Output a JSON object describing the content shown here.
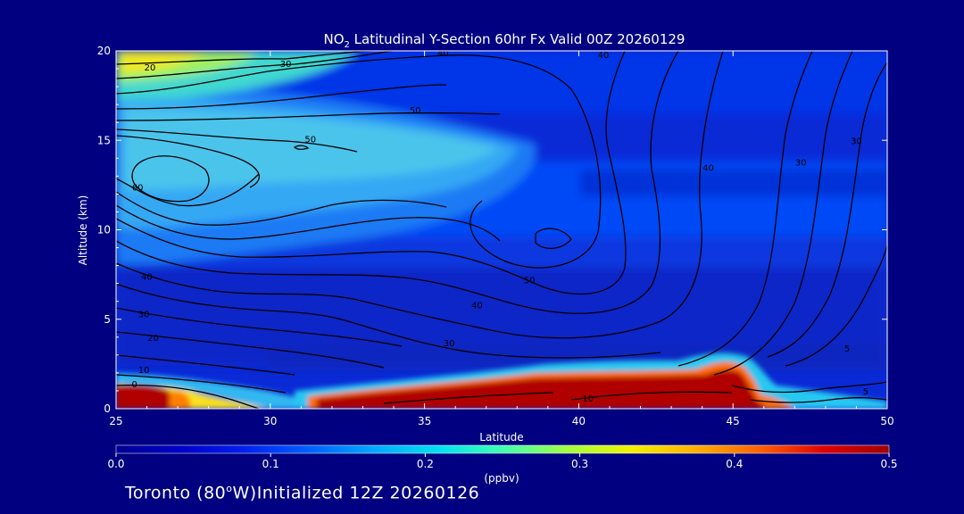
{
  "chart_data": {
    "type": "heatmap",
    "title_prefix": "NO",
    "title_sub": "2",
    "title_suffix": " Latitudinal Y-Section 60hr  Fx Valid 00Z 20260129",
    "xlabel": "Latitude",
    "ylabel": "Altitude (km)",
    "xlim": [
      25,
      50
    ],
    "ylim": [
      0,
      20
    ],
    "x_ticks": [
      "25",
      "30",
      "35",
      "40",
      "45",
      "50"
    ],
    "y_ticks": [
      "0",
      "5",
      "10",
      "15",
      "20"
    ],
    "colorbar": {
      "label": "(ppbv)",
      "ticks": [
        "0.0",
        "0.1",
        "0.2",
        "0.3",
        "0.4",
        "0.5"
      ],
      "range": [
        0,
        0.5
      ]
    },
    "colormap": [
      "#000090",
      "#0000c8",
      "#0020f0",
      "#0060ff",
      "#00a8ff",
      "#00e0f0",
      "#40ffb0",
      "#a0ff40",
      "#f0f000",
      "#ffb000",
      "#ff6000",
      "#e00000",
      "#a00000"
    ],
    "contour_labels": [
      {
        "text": "20",
        "x": 26.1,
        "y": 18.9
      },
      {
        "text": "30",
        "x": 30.5,
        "y": 19.1
      },
      {
        "text": "40",
        "x": 35.6,
        "y": 19.7
      },
      {
        "text": "50",
        "x": 34.7,
        "y": 16.5
      },
      {
        "text": "50",
        "x": 31.3,
        "y": 14.9
      },
      {
        "text": "60",
        "x": 25.7,
        "y": 12.2
      },
      {
        "text": "50",
        "x": 38.4,
        "y": 7.0
      },
      {
        "text": "40",
        "x": 36.7,
        "y": 5.6
      },
      {
        "text": "30",
        "x": 35.8,
        "y": 3.5
      },
      {
        "text": "40",
        "x": 26.0,
        "y": 7.2
      },
      {
        "text": "30",
        "x": 25.9,
        "y": 5.1
      },
      {
        "text": "20",
        "x": 26.2,
        "y": 3.8
      },
      {
        "text": "10",
        "x": 25.9,
        "y": 2.0
      },
      {
        "text": "0",
        "x": 25.6,
        "y": 1.2
      },
      {
        "text": "10",
        "x": 40.3,
        "y": 0.4
      },
      {
        "text": "5",
        "x": 48.7,
        "y": 3.2
      },
      {
        "text": "5",
        "x": 49.3,
        "y": 0.8
      },
      {
        "text": "40",
        "x": 44.2,
        "y": 13.3
      },
      {
        "text": "40",
        "x": 40.8,
        "y": 19.6
      },
      {
        "text": "30",
        "x": 47.2,
        "y": 13.6
      },
      {
        "text": "30",
        "x": 49.0,
        "y": 14.8
      }
    ]
  },
  "footer": {
    "text_a": "Toronto (80",
    "deg": "o",
    "text_b": "W)Initialized 12Z 20260126"
  }
}
